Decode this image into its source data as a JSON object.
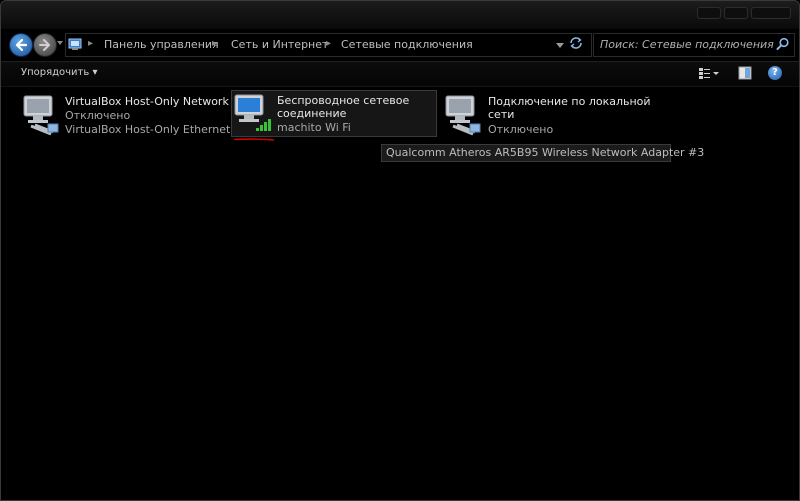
{
  "address": {
    "breadcrumbs": [
      "Панель управления",
      "Сеть и Интернет",
      "Сетевые подключения"
    ],
    "search_placeholder": "Поиск: Сетевые подключения"
  },
  "toolbar": {
    "organize_label": "Упорядочить",
    "organize_arrow": "▾"
  },
  "connections": [
    {
      "name": "VirtualBox Host-Only Network",
      "status": "Отключено",
      "device": "VirtualBox Host-Only Ethernet..."
    },
    {
      "name_line1": "Беспроводное сетевое",
      "name_line2": "соединение",
      "status": "machito Wi Fi",
      "selected": true
    },
    {
      "name_line1": "Подключение по локальной",
      "name_line2": "сети",
      "status": "Отключено"
    }
  ],
  "tooltip": "Qualcomm Atheros AR5B95 Wireless Network Adapter #3",
  "help_label": "?",
  "colors": {
    "background": "#000000",
    "text": "#e8e8e8",
    "status_text": "#a8a8a8",
    "underline": "#d10000",
    "signal": "#37c23a"
  },
  "icons": {
    "back": "back-arrow-icon",
    "forward": "forward-arrow-icon",
    "refresh": "refresh-icon",
    "search": "search-icon",
    "views": "views-icon",
    "preview": "preview-pane-icon",
    "help": "help-icon",
    "network": "network-adapter-icon",
    "wireless": "wireless-adapter-icon"
  }
}
